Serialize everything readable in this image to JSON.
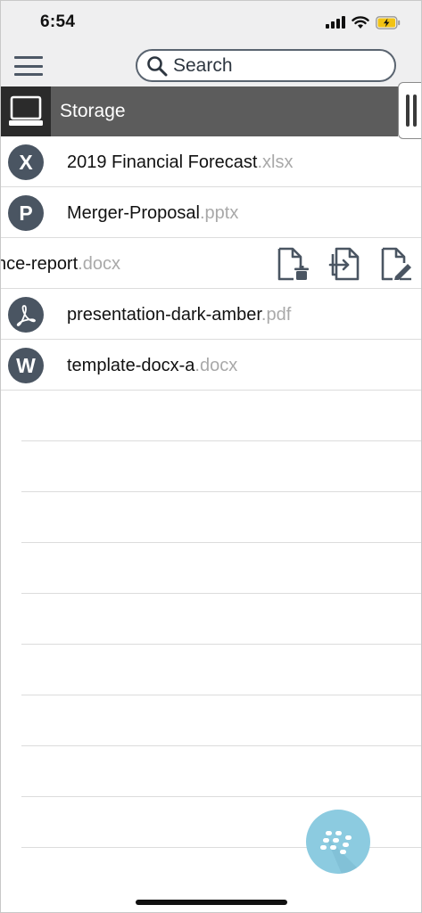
{
  "status_bar": {
    "time": "6:54",
    "icons": [
      "signal-icon",
      "wifi-icon",
      "battery-charging-icon"
    ]
  },
  "toolbar": {
    "menu_icon": "hamburger-menu-icon",
    "search": {
      "placeholder": "Search",
      "icon": "search-icon"
    }
  },
  "storage": {
    "label": "Storage",
    "icon": "laptop-icon"
  },
  "files": [
    {
      "badge": "X",
      "name": "2019 Financial Forecast",
      "ext": ".xlsx"
    },
    {
      "badge": "P",
      "name": "Merger-Proposal",
      "ext": ".pptx"
    },
    {
      "badge": "",
      "name": "nce-report",
      "ext": ".docx",
      "swiped": true,
      "actions": [
        "delete-file-icon",
        "move-file-icon",
        "rename-file-icon"
      ]
    },
    {
      "badge": "pdf-logo",
      "name": "presentation-dark-amber",
      "ext": ".pdf"
    },
    {
      "badge": "W",
      "name": "template-docx-a",
      "ext": ".docx"
    }
  ],
  "colors": {
    "toolbar_bg": "#efeff0",
    "header_bg": "#5c5c5c",
    "avatar_bg": "#4a5562",
    "extension_text": "#a9a9a9",
    "fab_bg": "#8ccbe0"
  },
  "fab": {
    "icon": "blackberry-logo-icon"
  }
}
